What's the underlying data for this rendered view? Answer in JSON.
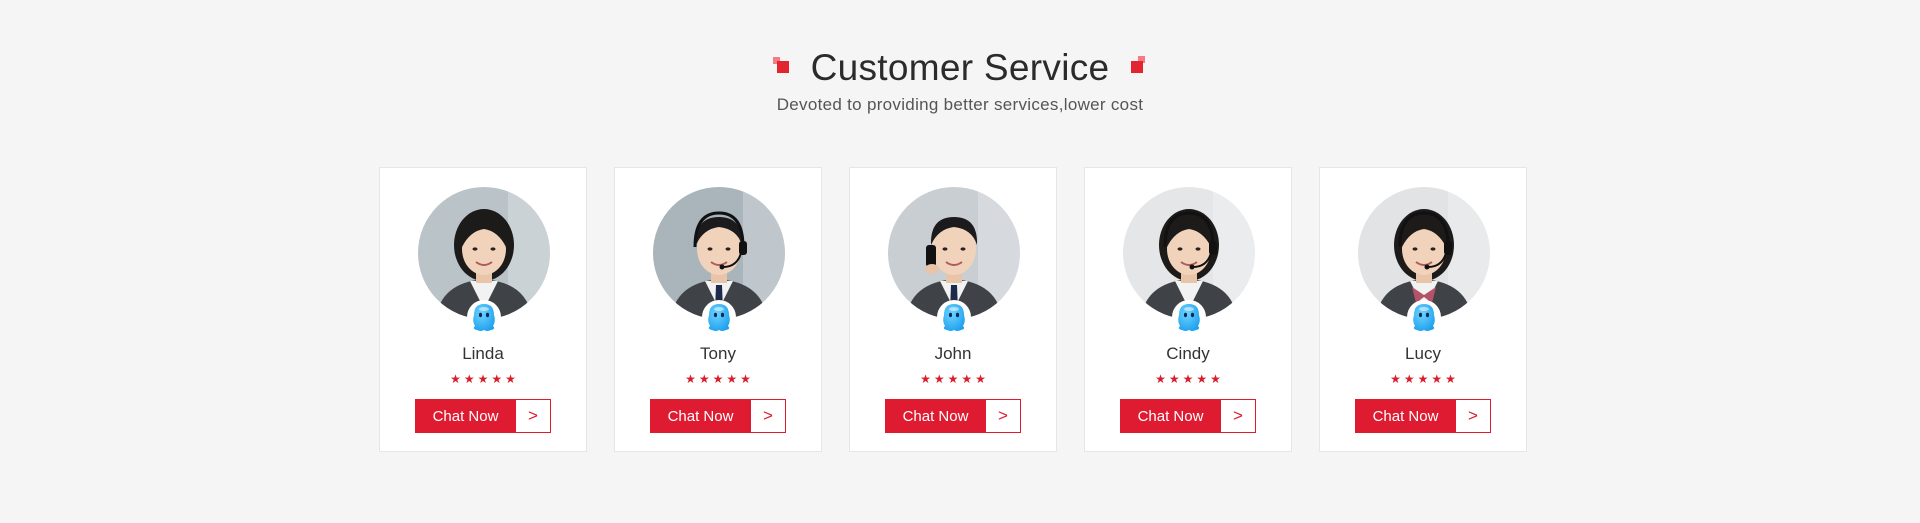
{
  "section": {
    "title": "Customer Service",
    "subtitle": "Devoted to providing better services,lower cost"
  },
  "colors": {
    "accent": "#de1b30",
    "deco_main": "#e4242f",
    "deco_light": "#f47a83",
    "background": "#f5f5f5",
    "badge_blue": "#1ea0ee"
  },
  "agents": [
    {
      "name": "Linda",
      "rating": 5,
      "button": "Chat Now",
      "arrow": ">",
      "gender": "female",
      "headset": false
    },
    {
      "name": "Tony",
      "rating": 5,
      "button": "Chat Now",
      "arrow": ">",
      "gender": "male",
      "headset": true
    },
    {
      "name": "John",
      "rating": 5,
      "button": "Chat Now",
      "arrow": ">",
      "gender": "male",
      "headset": false
    },
    {
      "name": "Cindy",
      "rating": 5,
      "button": "Chat Now",
      "arrow": ">",
      "gender": "female",
      "headset": true
    },
    {
      "name": "Lucy",
      "rating": 5,
      "button": "Chat Now",
      "arrow": ">",
      "gender": "female",
      "headset": true
    }
  ],
  "icons": {
    "title_left": "decor-squares-icon",
    "title_right": "decor-squares-icon",
    "badge": "qq-chat-icon",
    "star": "star-icon",
    "arrow": "chevron-right-icon"
  }
}
